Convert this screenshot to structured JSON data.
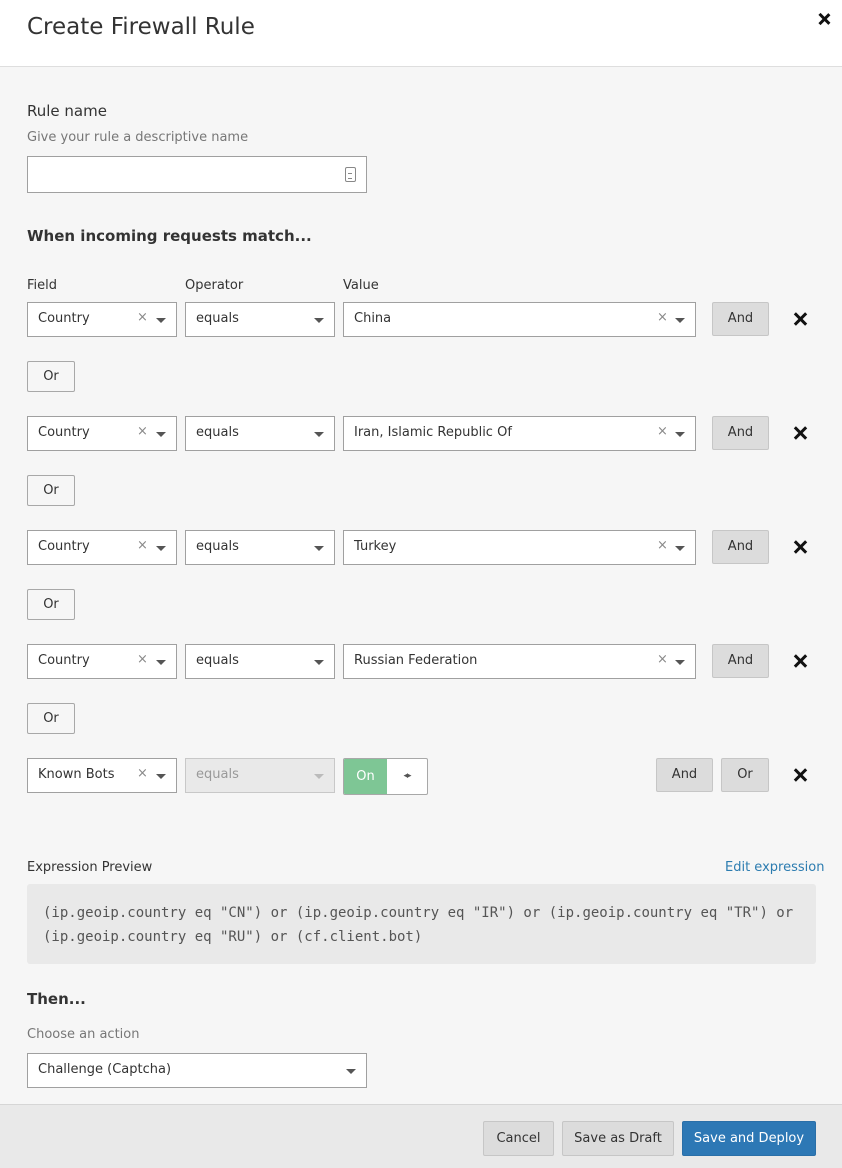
{
  "header": {
    "title": "Create Firewall Rule"
  },
  "rule_name": {
    "label": "Rule name",
    "hint": "Give your rule a descriptive name",
    "value": ""
  },
  "match": {
    "heading": "When incoming requests match...",
    "col_field": "Field",
    "col_operator": "Operator",
    "col_value": "Value",
    "rows": [
      {
        "field": "Country",
        "operator": "equals",
        "value": "China"
      },
      {
        "field": "Country",
        "operator": "equals",
        "value": "Iran, Islamic Republic Of"
      },
      {
        "field": "Country",
        "operator": "equals",
        "value": "Turkey"
      },
      {
        "field": "Country",
        "operator": "equals",
        "value": "Russian Federation"
      },
      {
        "field": "Known Bots",
        "operator": "equals",
        "value": "On"
      }
    ],
    "and_label": "And",
    "or_label": "Or",
    "clear_glyph": "×"
  },
  "preview": {
    "label": "Expression Preview",
    "edit_link": "Edit expression",
    "expression": "(ip.geoip.country eq \"CN\") or (ip.geoip.country eq \"IR\") or (ip.geoip.country eq \"TR\") or (ip.geoip.country eq \"RU\") or (cf.client.bot)"
  },
  "then": {
    "heading": "Then...",
    "hint": "Choose an action",
    "action": "Challenge (Captcha)"
  },
  "footer": {
    "cancel": "Cancel",
    "save_draft": "Save as Draft",
    "save_deploy": "Save and Deploy"
  },
  "colors": {
    "primary": "#2d78b5",
    "toggle_on": "#7ec695",
    "link": "#2c7cb0"
  }
}
